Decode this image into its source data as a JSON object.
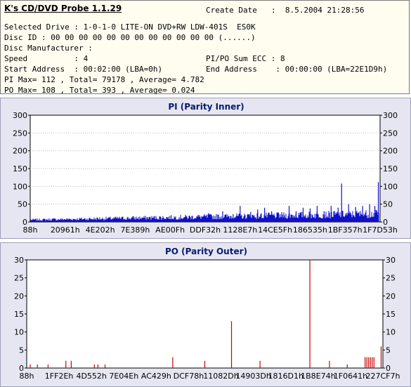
{
  "app": {
    "title": "K's CD/DVD Probe 1.1.29"
  },
  "info": {
    "create_date_label": "Create Date",
    "create_date_value": ":  8.5.2004 21:28:56",
    "selected_drive": "Selected Drive : 1-0-1-0 LITE-ON DVD+RW LDW-401S  ES0K",
    "disc_id": "Disc ID : 00 00 00 00 00 00 00 00 00 00 00 00 (......)",
    "disc_manufacturer": "Disc Manufacturer :",
    "speed": "Speed          : 4",
    "sum_ecc": "PI/PO Sum ECC : 8",
    "start_address": "Start Address  : 00:02:00 (LBA=0h)",
    "end_address": "End Address    : 00:00:00 (LBA=22E1D9h)",
    "pi_stats": "PI Max= 112 , Total= 79178 , Average= 4.782",
    "po_stats": "PO Max= 108 , Total= 393 , Average= 0.024"
  },
  "chart_data": [
    {
      "type": "bar",
      "title": "PI (Parity Inner)",
      "ylim": [
        0,
        300
      ],
      "yticks": [
        0,
        50,
        100,
        150,
        200,
        250,
        300
      ],
      "xticks": [
        "88h",
        "20961h",
        "4E202h",
        "7E389h",
        "AE00Fh",
        "DDF32h",
        "1128E7h",
        "14CE5Fh",
        "186535h",
        "1BF357h",
        "1F7D53h"
      ],
      "grid": true,
      "color": "#1010c8",
      "spikes": [
        {
          "x": 0.48,
          "y": 20
        },
        {
          "x": 0.51,
          "y": 25
        },
        {
          "x": 0.55,
          "y": 30
        },
        {
          "x": 0.58,
          "y": 22
        },
        {
          "x": 0.6,
          "y": 45
        },
        {
          "x": 0.63,
          "y": 28
        },
        {
          "x": 0.65,
          "y": 35
        },
        {
          "x": 0.67,
          "y": 40
        },
        {
          "x": 0.69,
          "y": 30
        },
        {
          "x": 0.71,
          "y": 25
        },
        {
          "x": 0.74,
          "y": 45
        },
        {
          "x": 0.76,
          "y": 30
        },
        {
          "x": 0.78,
          "y": 40
        },
        {
          "x": 0.8,
          "y": 38
        },
        {
          "x": 0.82,
          "y": 45
        },
        {
          "x": 0.84,
          "y": 30
        },
        {
          "x": 0.86,
          "y": 45
        },
        {
          "x": 0.88,
          "y": 40
        },
        {
          "x": 0.89,
          "y": 108
        },
        {
          "x": 0.91,
          "y": 50
        },
        {
          "x": 0.93,
          "y": 42
        },
        {
          "x": 0.95,
          "y": 45
        },
        {
          "x": 0.97,
          "y": 50
        },
        {
          "x": 0.985,
          "y": 45
        },
        {
          "x": 0.995,
          "y": 112
        }
      ]
    },
    {
      "type": "bar",
      "title": "PO (Parity Outer)",
      "ylim": [
        0,
        30
      ],
      "yticks": [
        0,
        5,
        10,
        15,
        20,
        25,
        30
      ],
      "xticks": [
        "88h",
        "1FF2Eh",
        "4D552h",
        "7E04Eh",
        "AC429h",
        "DCF78h",
        "11082Dh",
        "14903Dh",
        "1816D1h",
        "1B8E74h",
        "1F0641h",
        "227CF7h"
      ],
      "grid": false,
      "color": "#cc0000",
      "spikes": [
        {
          "x": 0.01,
          "y": 1
        },
        {
          "x": 0.03,
          "y": 1
        },
        {
          "x": 0.06,
          "y": 1
        },
        {
          "x": 0.11,
          "y": 2
        },
        {
          "x": 0.125,
          "y": 2
        },
        {
          "x": 0.19,
          "y": 1
        },
        {
          "x": 0.2,
          "y": 1
        },
        {
          "x": 0.22,
          "y": 1
        },
        {
          "x": 0.41,
          "y": 3
        },
        {
          "x": 0.5,
          "y": 2
        },
        {
          "x": 0.575,
          "y": 13
        },
        {
          "x": 0.655,
          "y": 2
        },
        {
          "x": 0.795,
          "y": 30
        },
        {
          "x": 0.85,
          "y": 2
        },
        {
          "x": 0.9,
          "y": 1
        },
        {
          "x": 0.95,
          "y": 3
        },
        {
          "x": 0.955,
          "y": 3
        },
        {
          "x": 0.96,
          "y": 3
        },
        {
          "x": 0.965,
          "y": 3
        },
        {
          "x": 0.97,
          "y": 3
        },
        {
          "x": 0.975,
          "y": 3
        },
        {
          "x": 0.995,
          "y": 6
        }
      ]
    }
  ]
}
